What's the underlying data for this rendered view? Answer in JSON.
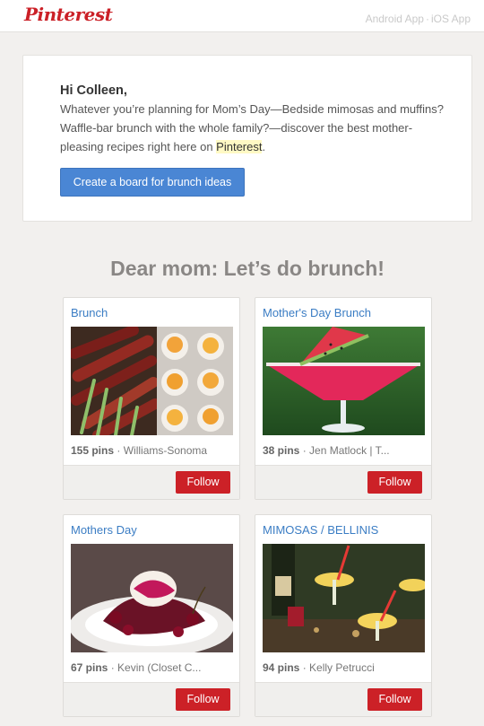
{
  "header": {
    "logo": "Pinterest",
    "android_link": "Android App",
    "separator": "·",
    "ios_link": "iOS App"
  },
  "intro": {
    "greeting": "Hi Colleen,",
    "body_before": "Whatever you’re planning for Mom’s Day—Bedside mimosas and muffins? Waffle-bar brunch with the whole family?—discover the best mother-pleasing recipes right here on ",
    "highlight": "Pinterest",
    "body_after": ".",
    "cta_label": "Create a board for brunch ideas"
  },
  "section": {
    "title": "Dear mom: Let’s do brunch!"
  },
  "boards": [
    {
      "title": "Brunch",
      "pins": "155 pins",
      "separator": "·",
      "owner": "Williams-Sonoma",
      "follow_label": "Follow",
      "image": "asparagus-and-eggs-photo"
    },
    {
      "title": "Mother's Day Brunch",
      "pins": "38 pins",
      "separator": "·",
      "owner": "Jen Matlock | T...",
      "follow_label": "Follow",
      "image": "watermelon-cocktail-photo"
    },
    {
      "title": "Mothers Day",
      "pins": "67 pins",
      "separator": "·",
      "owner": "Kevin (Closet C...",
      "follow_label": "Follow",
      "image": "cherry-dessert-photo"
    },
    {
      "title": "MIMOSAS / BELLINIS",
      "pins": "94 pins",
      "separator": "·",
      "owner": "Kelly Petrucci",
      "follow_label": "Follow",
      "image": "mimosa-glasses-photo"
    }
  ],
  "colors": {
    "brand_red": "#cb2027",
    "link_blue": "#3b7dc4",
    "button_blue": "#4a86d4",
    "highlight_yellow": "#fff9c4",
    "background": "#f2f0ee"
  }
}
